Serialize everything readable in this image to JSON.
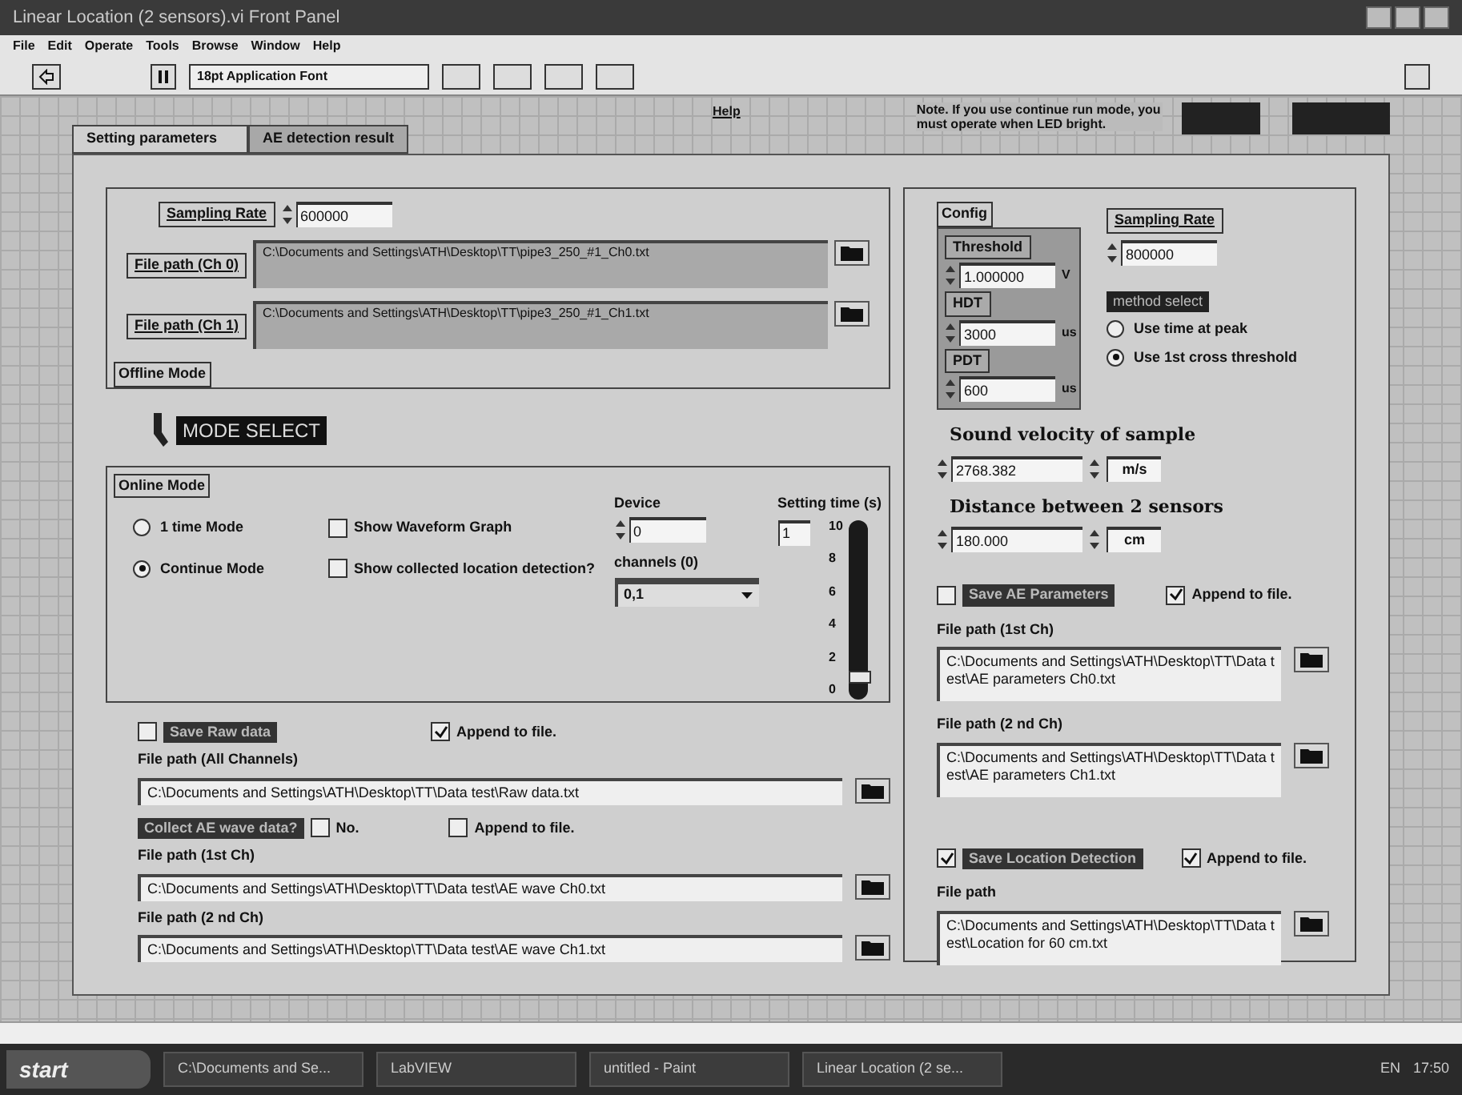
{
  "window": {
    "title": "Linear Location (2 sensors).vi Front Panel"
  },
  "menu": [
    "File",
    "Edit",
    "Operate",
    "Tools",
    "Browse",
    "Window",
    "Help"
  ],
  "toolbar": {
    "font": "18pt Application Font"
  },
  "header": {
    "help": "Help",
    "note": "Note. If you use continue run mode, you must operate when LED bright."
  },
  "tabs": [
    {
      "label": "Setting parameters",
      "selected": true
    },
    {
      "label": "AE detection result",
      "selected": false
    }
  ],
  "offline": {
    "caption": "Offline Mode",
    "sampling_rate": {
      "label": "Sampling Rate",
      "value": "600000"
    },
    "paths": [
      {
        "label": "File path (Ch 0)",
        "value": "C:\\Documents and Settings\\ATH\\Desktop\\TT\\pipe3_250_#1_Ch0.txt"
      },
      {
        "label": "File path (Ch 1)",
        "value": "C:\\Documents and Settings\\ATH\\Desktop\\TT\\pipe3_250_#1_Ch1.txt"
      }
    ]
  },
  "mode_select": {
    "label": "MODE SELECT"
  },
  "online": {
    "caption": "Online Mode",
    "modes": [
      {
        "label": "1 time Mode",
        "selected": false
      },
      {
        "label": "Continue Mode",
        "selected": true
      }
    ],
    "options": [
      {
        "label": "Show Waveform Graph",
        "checked": false
      },
      {
        "label": "Show collected location detection?",
        "checked": false
      }
    ],
    "device": {
      "label": "Device",
      "value": "0"
    },
    "channels": {
      "label": "channels (0)",
      "value": "0,1"
    },
    "setting_time": {
      "label": "Setting time (s)",
      "value": "1",
      "level": 0.1,
      "ticks": [
        "10",
        "8",
        "6",
        "4",
        "2",
        "0"
      ]
    }
  },
  "raw_data": {
    "save": {
      "label": "Save Raw data",
      "checked": false
    },
    "append": {
      "label": "Append to file.",
      "checked": true
    },
    "path_label": "File path (All Channels)",
    "path": "C:\\Documents and Settings\\ATH\\Desktop\\TT\\Data test\\Raw data.txt"
  },
  "ae_wave": {
    "question": "Collect AE wave data?",
    "no": {
      "label": "No.",
      "checked": false
    },
    "append": {
      "label": "Append to file.",
      "checked": false
    },
    "paths": [
      {
        "label": "File path (1st Ch)",
        "value": "C:\\Documents and Settings\\ATH\\Desktop\\TT\\Data test\\AE wave Ch0.txt"
      },
      {
        "label": "File path (2 nd Ch)",
        "value": "C:\\Documents and Settings\\ATH\\Desktop\\TT\\Data test\\AE wave Ch1.txt"
      }
    ]
  },
  "config": {
    "caption": "Config",
    "fields": [
      {
        "label": "Threshold",
        "value": "1.000000",
        "unit": "V"
      },
      {
        "label": "HDT",
        "value": "3000",
        "unit": "us"
      },
      {
        "label": "PDT",
        "value": "600",
        "unit": "us"
      }
    ]
  },
  "sampling_rate": {
    "label": "Sampling Rate",
    "value": "800000"
  },
  "method": {
    "label": "method select",
    "options": [
      {
        "label": "Use time at peak",
        "selected": false
      },
      {
        "label": "Use 1st cross threshold",
        "selected": true
      }
    ]
  },
  "velocity": {
    "label": "Sound velocity of sample",
    "value": "2768.382",
    "unit": "m/s"
  },
  "distance": {
    "label": "Distance between 2 sensors",
    "value": "180.000",
    "unit": "cm"
  },
  "ae_params": {
    "save": {
      "label": "Save AE Parameters",
      "checked": false
    },
    "append": {
      "label": "Append to file.",
      "checked": true
    },
    "paths": [
      {
        "label": "File path (1st Ch)",
        "value": "C:\\Documents and Settings\\ATH\\Desktop\\TT\\Data test\\AE parameters Ch0.txt"
      },
      {
        "label": "File path (2 nd Ch)",
        "value": "C:\\Documents and Settings\\ATH\\Desktop\\TT\\Data test\\AE parameters Ch1.txt"
      }
    ]
  },
  "location": {
    "save": {
      "label": "Save Location Detection",
      "checked": true
    },
    "append": {
      "label": "Append to file.",
      "checked": true
    },
    "path_label": "File path",
    "path": "C:\\Documents and Settings\\ATH\\Desktop\\TT\\Data test\\Location for 60 cm.txt"
  },
  "taskbar": {
    "start": "start",
    "items": [
      "C:\\Documents and Se...",
      "LabVIEW",
      "untitled - Paint",
      "Linear Location (2 se..."
    ],
    "lang": "EN",
    "clock": "17:50"
  }
}
